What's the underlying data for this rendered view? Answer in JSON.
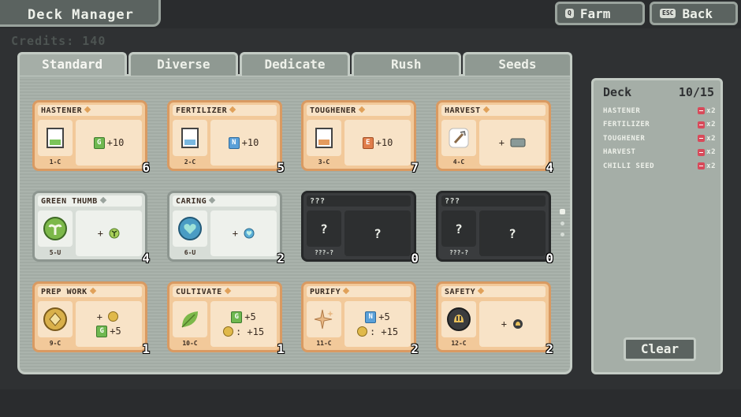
{
  "header": {
    "title": "Deck  Manager",
    "farm_label": "Farm",
    "farm_key": "Q",
    "back_label": "Back",
    "back_key": "ESC"
  },
  "credits": "Credits:  140",
  "tabs": [
    "Standard",
    "Diverse",
    "Dedicate",
    "Rush",
    "Seeds"
  ],
  "cards": [
    {
      "name": "HASTENER",
      "code": "1-C",
      "count": "6",
      "effect1": "+10",
      "badge1": "G"
    },
    {
      "name": "FERTILIZER",
      "code": "2-C",
      "count": "5",
      "effect1": "+10",
      "badge1": "N"
    },
    {
      "name": "TOUGHENER",
      "code": "3-C",
      "count": "7",
      "effect1": "+10",
      "badge1": "E"
    },
    {
      "name": "HARVEST",
      "code": "4-C",
      "count": "4",
      "effect1": "+"
    },
    {
      "name": "GREEN THUMB",
      "code": "5-U",
      "count": "4",
      "effect1": "+"
    },
    {
      "name": "CARING",
      "code": "6-U",
      "count": "2",
      "effect1": "+"
    },
    {
      "name": "???",
      "code": "???-?",
      "count": "0",
      "icon_text": "?",
      "effect_text": "?"
    },
    {
      "name": "???",
      "code": "???-?",
      "count": "0",
      "icon_text": "?",
      "effect_text": "?"
    },
    {
      "name": "PREP WORK",
      "code": "9-C",
      "count": "1",
      "effect1": "+",
      "effect2": "+5",
      "badge2": "G"
    },
    {
      "name": "CULTIVATE",
      "code": "10-C",
      "count": "1",
      "effect1": "+5",
      "badge1": "G",
      "effect2": ": +15"
    },
    {
      "name": "PURIFY",
      "code": "11-C",
      "count": "2",
      "effect1": "+5",
      "badge1": "N",
      "effect2": ": +15"
    },
    {
      "name": "SAFETY",
      "code": "12-C",
      "count": "2",
      "effect1": "+"
    }
  ],
  "deck": {
    "title": "Deck",
    "count": "10/15",
    "items": [
      {
        "name": "HASTENER",
        "qty": "x2"
      },
      {
        "name": "FERTILIZER",
        "qty": "x2"
      },
      {
        "name": "TOUGHENER",
        "qty": "x2"
      },
      {
        "name": "HARVEST",
        "qty": "x2"
      },
      {
        "name": "CHILLI SEED",
        "qty": "x2"
      }
    ],
    "clear_label": "Clear"
  }
}
